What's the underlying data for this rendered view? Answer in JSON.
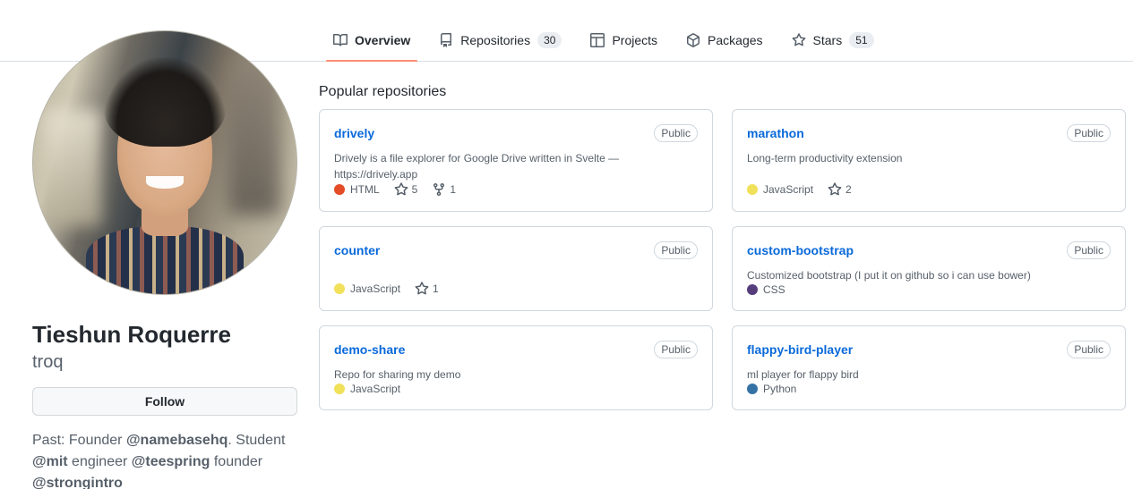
{
  "nav": {
    "items": [
      {
        "label": "Overview",
        "icon": "book-icon",
        "count": null,
        "active": true
      },
      {
        "label": "Repositories",
        "icon": "repo-icon",
        "count": "30",
        "active": false
      },
      {
        "label": "Projects",
        "icon": "table-icon",
        "count": null,
        "active": false
      },
      {
        "label": "Packages",
        "icon": "package-icon",
        "count": null,
        "active": false
      },
      {
        "label": "Stars",
        "icon": "star-icon",
        "count": "51",
        "active": false
      }
    ],
    "active_underline_color": "#fd8c73"
  },
  "profile": {
    "avatar_alt": "avatar",
    "name": "Tieshun Roquerre",
    "login": "troq",
    "follow_label": "Follow",
    "bio_parts": [
      {
        "text": "Past: Founder ",
        "bold": false
      },
      {
        "text": "@namebasehq",
        "bold": true
      },
      {
        "text": ". Student ",
        "bold": false
      },
      {
        "text": "@mit",
        "bold": true
      },
      {
        "text": " engineer ",
        "bold": false
      },
      {
        "text": "@teespring",
        "bold": true
      },
      {
        "text": " founder ",
        "bold": false
      },
      {
        "text": "@strongintro",
        "bold": true
      }
    ]
  },
  "repositories": {
    "heading": "Popular repositories",
    "visibility_label": "Public",
    "items": [
      {
        "name": "drively",
        "visibility": "Public",
        "description": "Drively is a file explorer for Google Drive written in Svelte — https://drively.app",
        "language": "HTML",
        "language_color": "#e34c26",
        "stars": "5",
        "forks": "1"
      },
      {
        "name": "marathon",
        "visibility": "Public",
        "description": "Long-term productivity extension",
        "language": "JavaScript",
        "language_color": "#f1e05a",
        "stars": "2",
        "forks": null
      },
      {
        "name": "counter",
        "visibility": "Public",
        "description": "",
        "language": "JavaScript",
        "language_color": "#f1e05a",
        "stars": "1",
        "forks": null
      },
      {
        "name": "custom-bootstrap",
        "visibility": "Public",
        "description": "Customized bootstrap (I put it on github so i can use bower)",
        "language": "CSS",
        "language_color": "#563d7c",
        "stars": null,
        "forks": null
      },
      {
        "name": "demo-share",
        "visibility": "Public",
        "description": "Repo for sharing my demo",
        "language": "JavaScript",
        "language_color": "#f1e05a",
        "stars": null,
        "forks": null
      },
      {
        "name": "flappy-bird-player",
        "visibility": "Public",
        "description": "ml player for flappy bird",
        "language": "Python",
        "language_color": "#3572A5",
        "stars": null,
        "forks": null
      }
    ]
  }
}
